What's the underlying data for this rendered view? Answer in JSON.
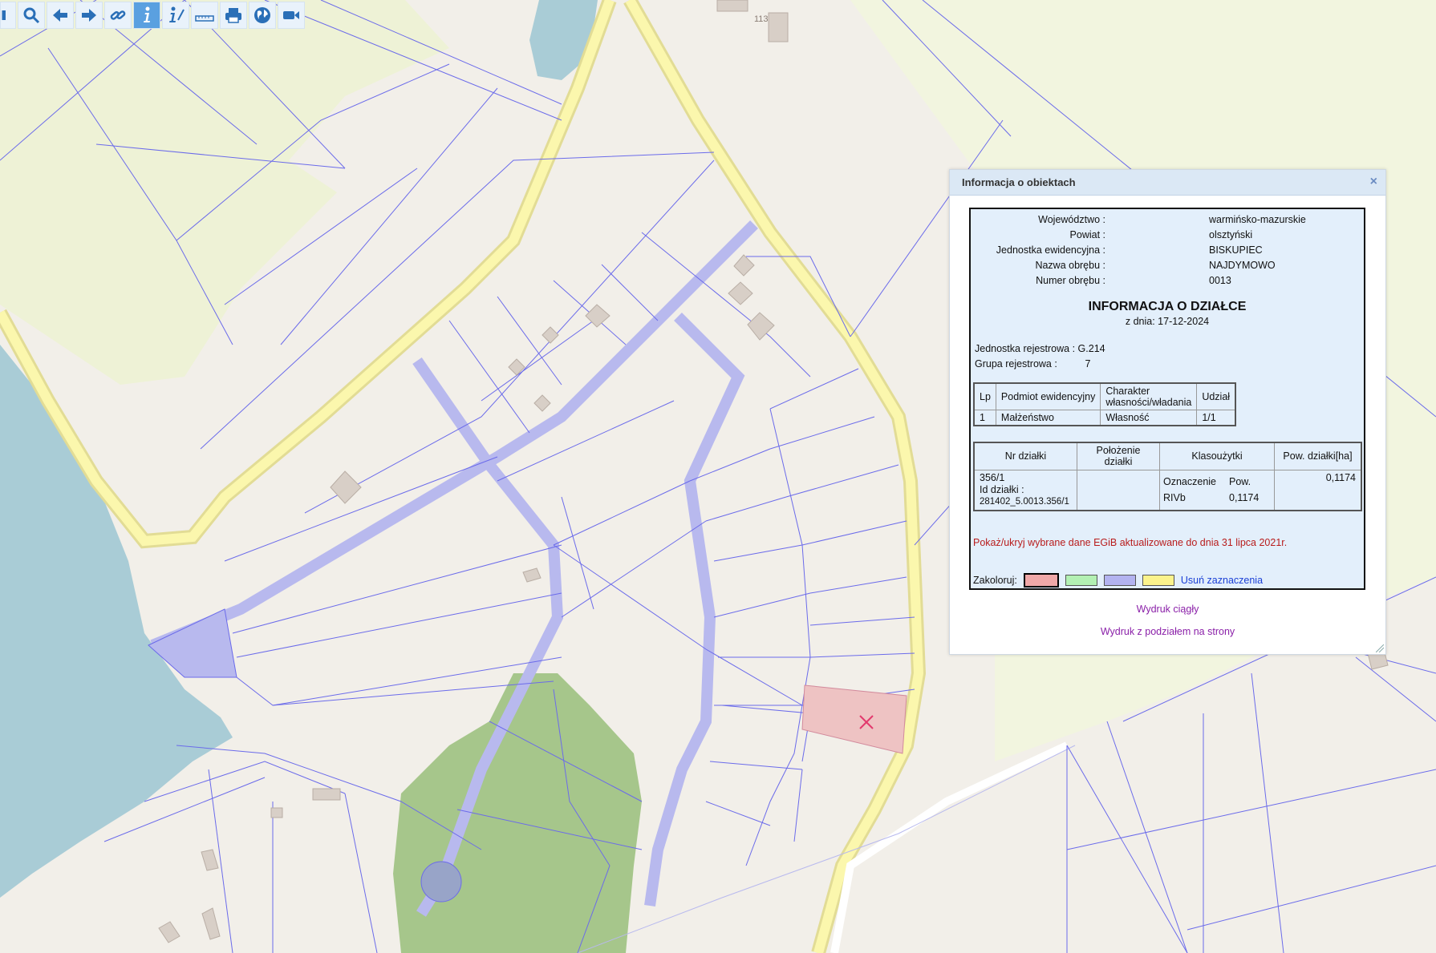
{
  "toolbar": {
    "buttons": [
      {
        "name": "pan-icon"
      },
      {
        "name": "zoom-icon"
      },
      {
        "name": "back-arrow-icon"
      },
      {
        "name": "forward-arrow-icon"
      },
      {
        "name": "link-icon"
      },
      {
        "name": "info-icon",
        "active": true
      },
      {
        "name": "info-edit-icon"
      },
      {
        "name": "ruler-icon"
      },
      {
        "name": "print-icon"
      },
      {
        "name": "globe-icon"
      },
      {
        "name": "camera-icon"
      }
    ]
  },
  "map": {
    "building_label": "113",
    "colors": {
      "background": "#f2efe9",
      "meadow": "#eef2d6",
      "water": "#a9ccd6",
      "forest": "#a6c68b",
      "road_fill": "#fbf7ad",
      "road_edge": "#e6e097",
      "parcel_line": "#6b6bea",
      "path_fill": "#b8b9ee",
      "building": "#d8cfc7",
      "highlight": "#eec3c3",
      "marker": "#e23a6d"
    }
  },
  "popup": {
    "title": "Informacja o obiektach",
    "address": [
      {
        "label": "Województwo :",
        "value": "warmińsko-mazurskie"
      },
      {
        "label": "Powiat :",
        "value": "olsztyński"
      },
      {
        "label": "Jednostka ewidencyjna :",
        "value": "BISKUPIEC"
      },
      {
        "label": "Nazwa obrębu :",
        "value": "NAJDYMOWO"
      },
      {
        "label": "Numer obrębu :",
        "value": "0013"
      }
    ],
    "heading": "INFORMACJA O DZIAŁCE",
    "date": "z dnia: 17-12-2024",
    "jednostka_rejestrowa_label": "Jednostka rejestrowa :",
    "jednostka_rejestrowa_value": "G.214",
    "grupa_rejestrowa_label": "Grupa rejestrowa :",
    "grupa_rejestrowa_value": "7",
    "owner_table": {
      "headers": [
        "Lp",
        "Podmiot ewidencyjny",
        "Charakter własności/władania",
        "Udział"
      ],
      "rows": [
        [
          "1",
          "Małżeństwo",
          "Własność",
          "1/1"
        ]
      ]
    },
    "parcel_table": {
      "headers": [
        "Nr działki",
        "Położenie działki",
        "Klasoużytki",
        "Pow. działki[ha]"
      ],
      "nr_dzialki": "356/1",
      "id_label": "Id działki :",
      "id_value": "281402_5.0013.356/1",
      "polozenie": "",
      "klasouzytki_headers": [
        "Oznaczenie",
        "Pow."
      ],
      "klasouzytki_rows": [
        [
          "RIVb",
          "0,1174"
        ]
      ],
      "pow_dzialki": "0,1174"
    },
    "egib_link": "Pokaż/ukryj wybrane dane EGiB aktualizowane do dnia 31 lipca 2021r.",
    "colorize_label": "Zakoloruj:",
    "swatches": [
      {
        "name": "pink",
        "color": "#f0a8a8",
        "selected": true
      },
      {
        "name": "green",
        "color": "#b3f0b3"
      },
      {
        "name": "blue",
        "color": "#b3b3f0"
      },
      {
        "name": "yellow",
        "color": "#fbf38c"
      }
    ],
    "clear_label": "Usuń zaznaczenia",
    "print_continuous": "Wydruk ciągły",
    "print_paged": "Wydruk z podziałem na strony"
  }
}
